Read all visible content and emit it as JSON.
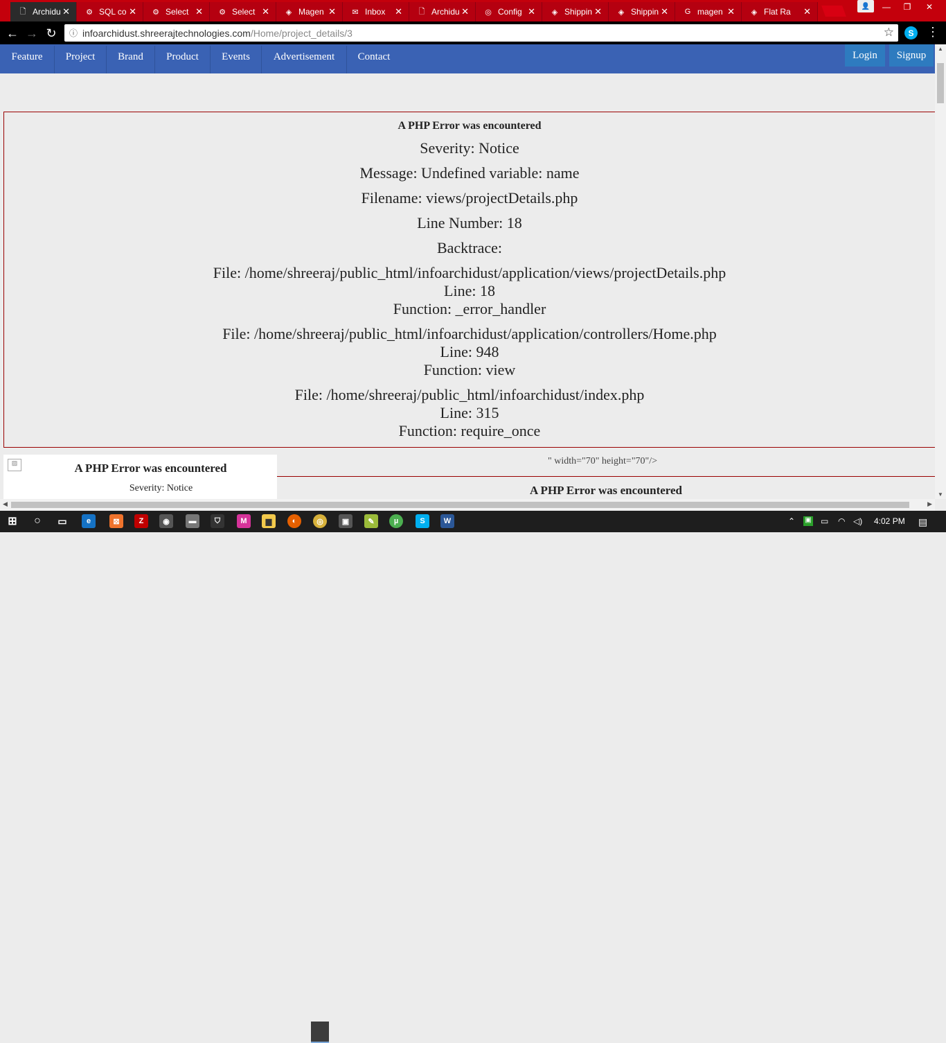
{
  "browser": {
    "tabs": [
      {
        "label": "Archidu",
        "icon": "doc-icon",
        "active": true
      },
      {
        "label": "SQL co",
        "icon": "phpmyadmin-icon"
      },
      {
        "label": "Select",
        "icon": "phpmyadmin-icon"
      },
      {
        "label": "Select",
        "icon": "phpmyadmin-icon"
      },
      {
        "label": "Magen",
        "icon": "magento-icon"
      },
      {
        "label": "Inbox",
        "icon": "gmail-icon"
      },
      {
        "label": "Archidu",
        "icon": "doc-icon"
      },
      {
        "label": "Config",
        "icon": "config-icon"
      },
      {
        "label": "Shippin",
        "icon": "magento-icon"
      },
      {
        "label": "Shippin",
        "icon": "magento-icon"
      },
      {
        "label": "magen",
        "icon": "google-icon"
      },
      {
        "label": "Flat Ra",
        "icon": "magento-icon"
      }
    ],
    "url_host": "infoarchidust.shreerajtechnologies.com",
    "url_path": "/Home/project_details/3"
  },
  "site": {
    "nav": [
      "Feature",
      "Project",
      "Brand",
      "Product",
      "Events",
      "Advertisement",
      "Contact"
    ],
    "login": "Login",
    "signup": "Signup"
  },
  "error": {
    "heading": "A PHP Error was encountered",
    "severity": "Severity: Notice",
    "message": "Message: Undefined variable: name",
    "filename": "Filename: views/projectDetails.php",
    "line_number": "Line Number: 18",
    "backtrace": "Backtrace:",
    "trace": [
      {
        "file": "File: /home/shreeraj/public_html/infoarchidust/application/views/projectDetails.php",
        "line": "Line: 18",
        "function": "Function: _error_handler"
      },
      {
        "file": "File: /home/shreeraj/public_html/infoarchidust/application/controllers/Home.php",
        "line": "Line: 948",
        "function": "Function: view"
      },
      {
        "file": "File: /home/shreeraj/public_html/infoarchidust/index.php",
        "line": "Line: 315",
        "function": "Function: require_once"
      }
    ]
  },
  "lower": {
    "card_heading": "A PHP Error was encountered",
    "card_severity": "Severity: Notice",
    "attr_text": "\" width=\"70\" height=\"70\"/>",
    "second_heading": "A PHP Error was encountered"
  },
  "taskbar": {
    "time": "4:02 PM"
  },
  "colors": {
    "tabbar": "#c4000c",
    "nav": "#3a62b4",
    "auth_button": "#2e7bbf",
    "error_border": "#990000"
  }
}
